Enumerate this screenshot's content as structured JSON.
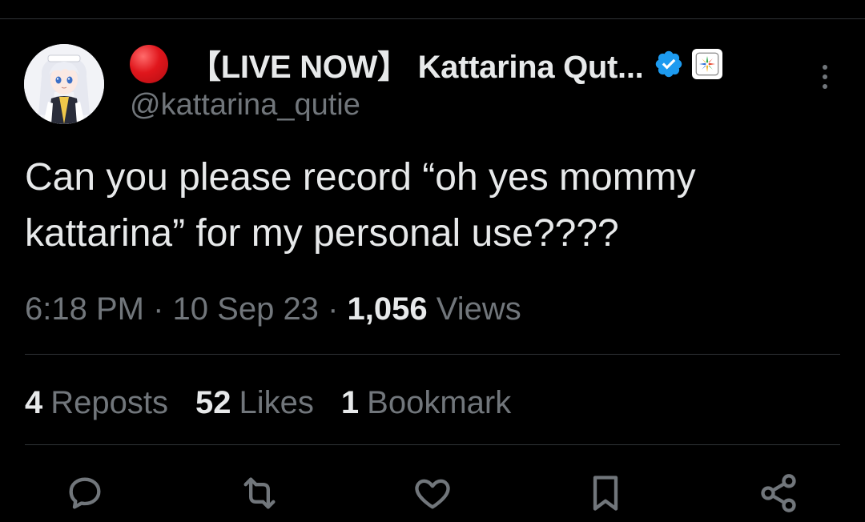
{
  "tweet": {
    "author": {
      "display_name": "【LIVE NOW】 Kattarina Qut...",
      "handle": "@kattarina_qutie",
      "verified": true,
      "avatar_icon": "anime-girl-avatar",
      "live_indicator_icon": "red-circle-emoji"
    },
    "text": "Can you please record “oh yes mommy kattarina” for my personal use????",
    "meta": {
      "time": "6:18 PM",
      "separator": "·",
      "date": "10 Sep 23",
      "views_count": "1,056",
      "views_label": "Views"
    },
    "stats": [
      {
        "count": "4",
        "label": "Reposts"
      },
      {
        "count": "52",
        "label": "Likes"
      },
      {
        "count": "1",
        "label": "Bookmark"
      }
    ],
    "actions": [
      "reply-icon",
      "repost-icon",
      "like-icon",
      "bookmark-icon",
      "share-icon"
    ]
  },
  "colors": {
    "background": "#000000",
    "primary_text": "#e7e9ea",
    "secondary_text": "#71767b",
    "divider": "#2f3336",
    "verified_blue": "#1d9bf0",
    "live_red": "#e0161c"
  }
}
